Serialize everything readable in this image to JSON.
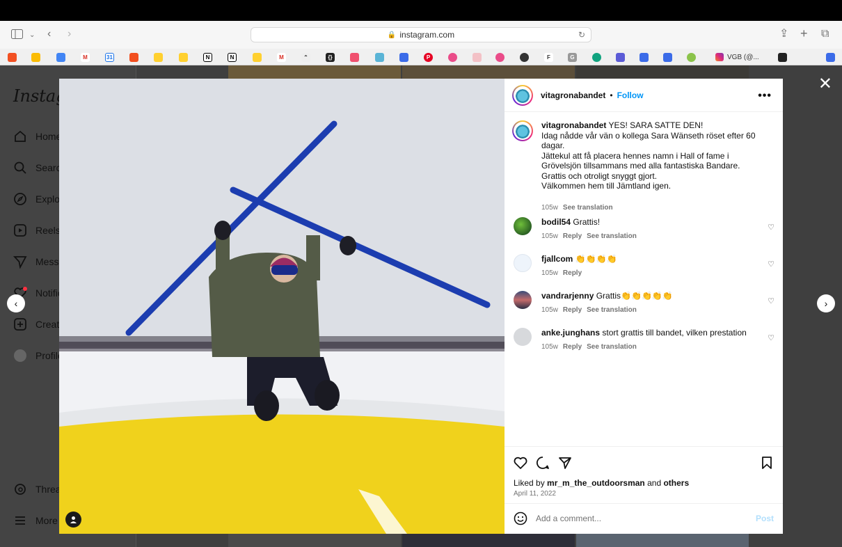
{
  "browser": {
    "url": "instagram.com",
    "tab_title": "VGB (@..."
  },
  "sidebar": {
    "logo": "Instagram",
    "items": [
      {
        "label": "Home",
        "icon": "home-icon"
      },
      {
        "label": "Search",
        "icon": "search-icon"
      },
      {
        "label": "Explore",
        "icon": "compass-icon"
      },
      {
        "label": "Reels",
        "icon": "reels-icon"
      },
      {
        "label": "Messages",
        "icon": "send-icon"
      },
      {
        "label": "Notifications",
        "icon": "heart-icon"
      },
      {
        "label": "Create",
        "icon": "plus-square-icon"
      },
      {
        "label": "Profile",
        "icon": "avatar-icon"
      },
      {
        "label": "Threads",
        "icon": "threads-icon"
      },
      {
        "label": "More",
        "icon": "menu-icon"
      }
    ]
  },
  "post": {
    "username": "vitagronabandet",
    "follow_label": "Follow",
    "caption_user": "vitagronabandet",
    "caption_lines": [
      "YES! SARA SATTE DEN!",
      "Idag nådde vår vän o kollega Sara Wänseth röset efter 60 dagar.",
      "Jättekul att få placera hennes namn i Hall of fame i Grövelsjön tillsammans med alla fantastiska Bandare.",
      "Grattis och otroligt snyggt gjort.",
      "Välkommen hem till Jämtland igen."
    ],
    "caption_age": "105w",
    "see_translation": "See translation",
    "comments": [
      {
        "user": "bodil54",
        "text": "Grattis!",
        "age": "105w",
        "reply": "Reply",
        "translate": "See translation"
      },
      {
        "user": "fjallcom",
        "text": "👏👏👏👏",
        "age": "105w",
        "reply": "Reply",
        "translate": ""
      },
      {
        "user": "vandrarjenny",
        "text": "Grattis👏👏👏👏👏",
        "age": "105w",
        "reply": "Reply",
        "translate": "See translation"
      },
      {
        "user": "anke.junghans",
        "text": "stort grattis till bandet, vilken prestation",
        "age": "105w",
        "reply": "Reply",
        "translate": "See translation"
      }
    ],
    "liked_by_prefix": "Liked by",
    "liked_by_user": "mr_m_the_outdoorsman",
    "liked_by_and": "and",
    "liked_by_others": "others",
    "date": "April 11, 2022",
    "add_comment_placeholder": "Add a comment...",
    "post_label": "Post"
  },
  "colors": {
    "accent": "#0095f6",
    "post_disabled": "#b2dffc",
    "yellow_cairn": "#f0d21c",
    "ski_blue": "#1c3db0"
  }
}
